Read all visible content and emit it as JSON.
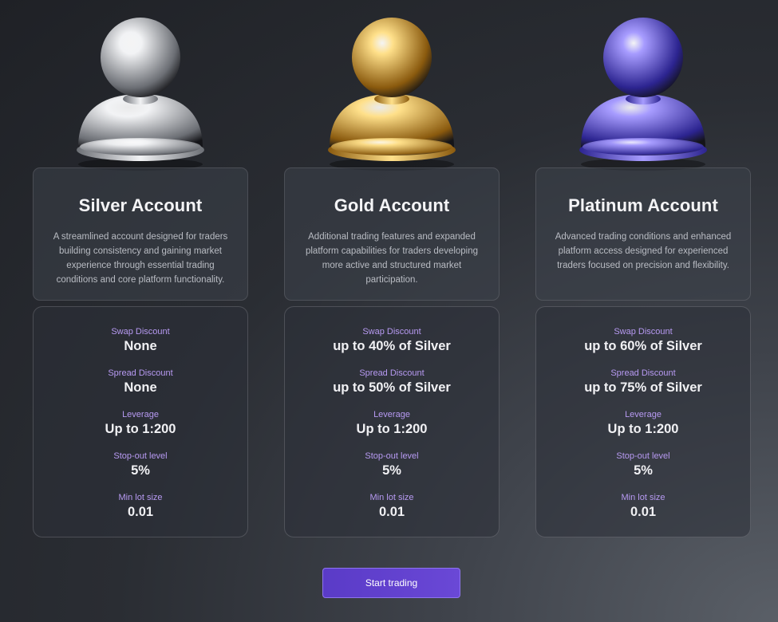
{
  "accounts": [
    {
      "title": "Silver Account",
      "description": "A streamlined account designed for traders building consistency and gaining market experience through essential trading conditions and core platform functionality.",
      "icon": "silver-pawn-icon",
      "color_light": "#f2f3f5",
      "color_dark": "#6c6f75",
      "specs": [
        {
          "label": "Swap Discount",
          "value": "None"
        },
        {
          "label": "Spread Discount",
          "value": "None"
        },
        {
          "label": "Leverage",
          "value": "Up to 1:200"
        },
        {
          "label": "Stop-out level",
          "value": "5%"
        },
        {
          "label": "Min lot size",
          "value": "0.01"
        }
      ]
    },
    {
      "title": "Gold Account",
      "description": "Additional trading features and expanded platform capabilities for traders developing more active and structured market participation.",
      "icon": "gold-pawn-icon",
      "color_light": "#ffe08a",
      "color_dark": "#8a5a0e",
      "specs": [
        {
          "label": "Swap Discount",
          "value": "up to 40% of Silver"
        },
        {
          "label": "Spread Discount",
          "value": "up to 50% of Silver"
        },
        {
          "label": "Leverage",
          "value": "Up to 1:200"
        },
        {
          "label": "Stop-out level",
          "value": "5%"
        },
        {
          "label": "Min lot size",
          "value": "0.01"
        }
      ]
    },
    {
      "title": "Platinum Account",
      "description": "Advanced trading conditions and enhanced platform access designed for experienced traders focused on precision and flexibility.",
      "icon": "platinum-pawn-icon",
      "color_light": "#a79cff",
      "color_dark": "#2c2490",
      "specs": [
        {
          "label": "Swap Discount",
          "value": "up to 60% of Silver"
        },
        {
          "label": "Spread Discount",
          "value": "up to 75% of Silver"
        },
        {
          "label": "Leverage",
          "value": "Up to 1:200"
        },
        {
          "label": "Stop-out level",
          "value": "5%"
        },
        {
          "label": "Min lot size",
          "value": "0.01"
        }
      ]
    }
  ],
  "cta": {
    "label": "Start trading"
  }
}
